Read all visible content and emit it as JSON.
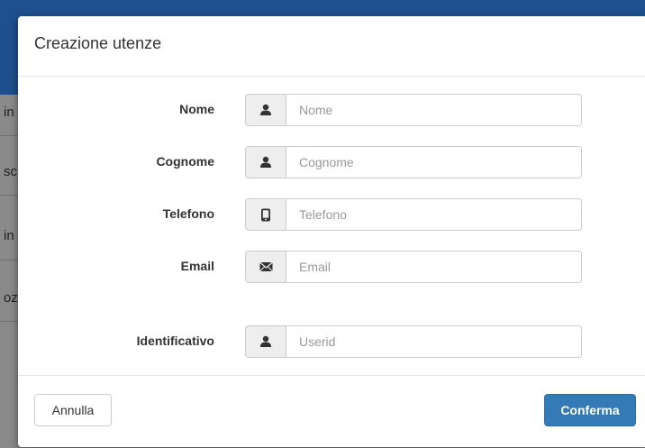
{
  "background": {
    "fragments": [
      "in",
      "sc",
      "in",
      "oz"
    ]
  },
  "modal": {
    "title": "Creazione utenze",
    "fields": [
      {
        "label": "Nome",
        "placeholder": "Nome",
        "icon": "user-icon"
      },
      {
        "label": "Cognome",
        "placeholder": "Cognome",
        "icon": "user-icon"
      },
      {
        "label": "Telefono",
        "placeholder": "Telefono",
        "icon": "phone-icon"
      },
      {
        "label": "Email",
        "placeholder": "Email",
        "icon": "envelope-icon"
      },
      {
        "label": "Identificativo",
        "placeholder": "Userid",
        "icon": "user-icon"
      }
    ],
    "cancel_label": "Annulla",
    "confirm_label": "Conferma"
  },
  "colors": {
    "primary": "#337ab7",
    "topbar": "#1f4f8e"
  }
}
